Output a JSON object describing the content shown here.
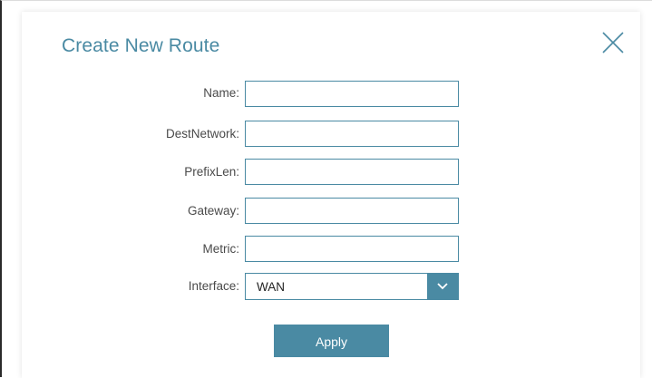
{
  "dialog": {
    "title": "Create New Route",
    "close_icon": "close-icon"
  },
  "form": {
    "name_label": "Name:",
    "name_value": "",
    "destnetwork_label": "DestNetwork:",
    "destnetwork_value": "",
    "prefixlen_label": "PrefixLen:",
    "prefixlen_value": "",
    "gateway_label": "Gateway:",
    "gateway_value": "",
    "metric_label": "Metric:",
    "metric_value": "",
    "interface_label": "Interface:",
    "interface_value": "WAN"
  },
  "actions": {
    "apply_label": "Apply"
  },
  "colors": {
    "accent": "#4a8aa3",
    "label_text": "#4a4a4a"
  }
}
